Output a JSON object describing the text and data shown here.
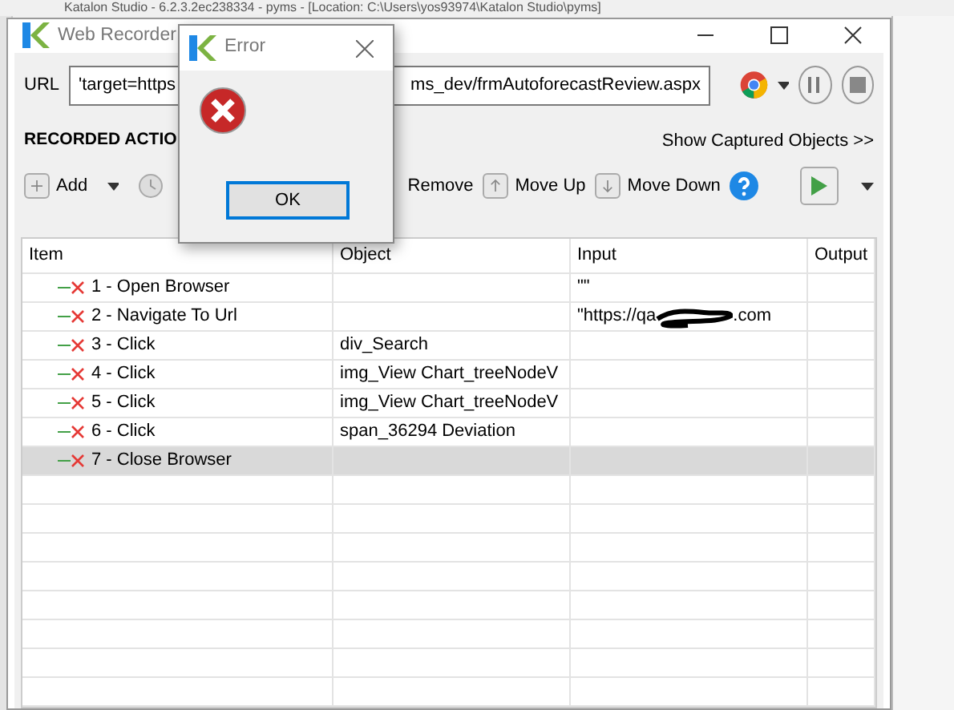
{
  "background_window": {
    "title": "Katalon Studio - 6.2.3.2ec238334 - pyms - [Location: C:\\Users\\yos93974\\Katalon Studio\\pyms]"
  },
  "window": {
    "title": "Web Recorder"
  },
  "url_bar": {
    "label": "URL",
    "value_start": "'target=https",
    "value_end": "ms_dev/frmAutoforecastReview.aspx"
  },
  "section_title": "RECORDED ACTIO",
  "show_objects_link": "Show Captured Objects >>",
  "toolbar": [
    {
      "kind": "add",
      "label": "Add"
    },
    {
      "kind": "history"
    },
    {
      "kind": "plain",
      "label": "Remove"
    },
    {
      "kind": "up",
      "label": "Move Up"
    },
    {
      "kind": "down",
      "label": "Move Down"
    }
  ],
  "table": {
    "columns": [
      "Item",
      "Object",
      "Input",
      "Output"
    ],
    "rows": [
      {
        "item": "1 - Open Browser",
        "object": "",
        "input": "\"\"",
        "selected": false
      },
      {
        "item": "2 - Navigate To Url",
        "object": "",
        "input": "\"https://qa",
        "input_tail": ".com",
        "redacted": true,
        "selected": false
      },
      {
        "item": "3 - Click",
        "object": "div_Search",
        "input": "",
        "selected": false
      },
      {
        "item": "4 - Click",
        "object": "img_View Chart_treeNodeV",
        "input": "",
        "selected": false
      },
      {
        "item": "5 - Click",
        "object": "img_View Chart_treeNodeV",
        "input": "",
        "selected": false
      },
      {
        "item": "6 - Click",
        "object": "span_36294 Deviation",
        "input": "",
        "selected": false
      },
      {
        "item": "7 - Close Browser",
        "object": "",
        "input": "",
        "selected": true
      }
    ]
  },
  "dialog": {
    "title": "Error",
    "button": "OK"
  }
}
